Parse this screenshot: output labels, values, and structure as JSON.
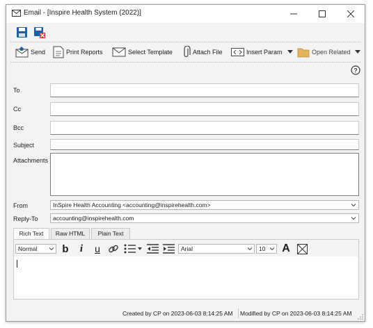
{
  "window": {
    "title": "Email -  [Inspire Health System (2022)]"
  },
  "quick_access": {
    "save": "save-icon",
    "save_close": "save-close-icon"
  },
  "toolbar": {
    "send": "Send",
    "print_reports": "Print Reports",
    "select_template": "Select Template",
    "attach_file": "Attach File",
    "insert_param": "Insert Param",
    "open_related": "Open Related"
  },
  "form": {
    "to_label": "To",
    "cc_label": "Cc",
    "bcc_label": "Bcc",
    "subject_label": "Subject",
    "attachments_label": "Attachments",
    "from_label": "From",
    "from_value": "InSpire Health Accounting <accounting@inspirehealth.com>",
    "replyto_label": "Reply-To",
    "replyto_value": "accounting@inspirehealth.com"
  },
  "editor": {
    "tabs": [
      "Rich Text",
      "Raw HTML",
      "Plain Text"
    ],
    "active_tab": "Rich Text",
    "style_value": "Normal",
    "font_value": "Arial",
    "size_value": "10"
  },
  "status": {
    "created": "Created by CP on 2023-06-03 8:14:25 AM",
    "modified": "Modified by CP on 2023-06-03 8:14:25 AM"
  },
  "colors": {
    "accent": "#1f5fa8",
    "save_red": "#d03a3a",
    "folder": "#e3b55a"
  }
}
